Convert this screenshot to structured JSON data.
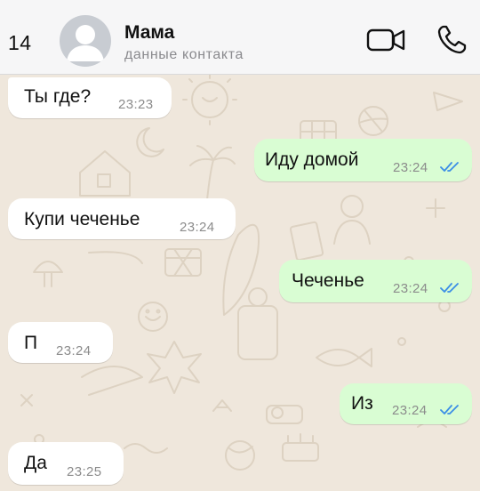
{
  "header": {
    "back_count": "14",
    "contact_name": "Мама",
    "contact_subtitle": "данные контакта",
    "icons": [
      "person-icon",
      "video-camera-icon",
      "phone-icon"
    ]
  },
  "messages": [
    {
      "direction": "incoming",
      "text": "Ты где?",
      "time": "23:23"
    },
    {
      "direction": "outgoing",
      "text": "Иду домой",
      "time": "23:24",
      "status": "read"
    },
    {
      "direction": "incoming",
      "text": "Купи чеченье",
      "time": "23:24"
    },
    {
      "direction": "outgoing",
      "text": "Чеченье",
      "time": "23:24",
      "status": "read"
    },
    {
      "direction": "incoming",
      "text": "П",
      "time": "23:24"
    },
    {
      "direction": "outgoing",
      "text": "Из",
      "time": "23:24",
      "status": "read"
    },
    {
      "direction": "incoming",
      "text": "Да",
      "time": "23:25"
    }
  ],
  "colors": {
    "incoming_bubble": "#ffffff",
    "outgoing_bubble": "#d9fdd3",
    "read_ticks": "#3b8ee6",
    "wallpaper": "#efe7dc"
  }
}
